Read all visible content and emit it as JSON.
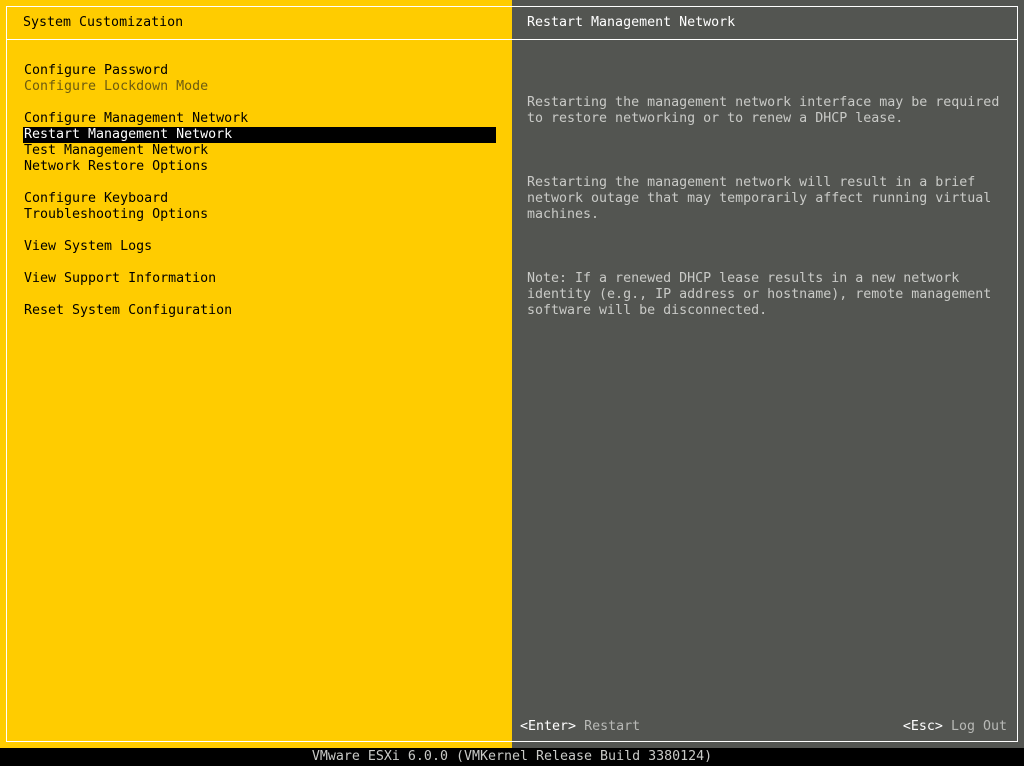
{
  "left_panel": {
    "title": "System Customization",
    "groups": [
      [
        {
          "label": "Configure Password",
          "state": "normal"
        },
        {
          "label": "Configure Lockdown Mode",
          "state": "disabled"
        }
      ],
      [
        {
          "label": "Configure Management Network",
          "state": "normal"
        },
        {
          "label": "Restart Management Network",
          "state": "selected"
        },
        {
          "label": "Test Management Network",
          "state": "normal"
        },
        {
          "label": "Network Restore Options",
          "state": "normal"
        }
      ],
      [
        {
          "label": "Configure Keyboard",
          "state": "normal"
        },
        {
          "label": "Troubleshooting Options",
          "state": "normal"
        }
      ],
      [
        {
          "label": "View System Logs",
          "state": "normal"
        }
      ],
      [
        {
          "label": "View Support Information",
          "state": "normal"
        }
      ],
      [
        {
          "label": "Reset System Configuration",
          "state": "normal"
        }
      ]
    ]
  },
  "right_panel": {
    "title": "Restart Management Network",
    "paragraphs": [
      "Restarting the management network interface may be required\nto restore networking or to renew a DHCP lease.",
      "Restarting the management network will result in a brief\nnetwork outage that may temporarily affect running virtual\nmachines.",
      "Note: If a renewed DHCP lease results in a new network\nidentity (e.g., IP address or hostname), remote management\nsoftware will be disconnected."
    ],
    "footer": {
      "enter_key": "<Enter>",
      "enter_action": "Restart",
      "esc_key": "<Esc>",
      "esc_action": "Log Out"
    }
  },
  "status_bar": {
    "text": "VMware ESXi 6.0.0 (VMKernel Release Build 3380124)"
  },
  "colors": {
    "left_bg": "#ffcc00",
    "right_bg": "#535551",
    "selection_bg": "#000000",
    "selection_fg": "#ffffff"
  }
}
